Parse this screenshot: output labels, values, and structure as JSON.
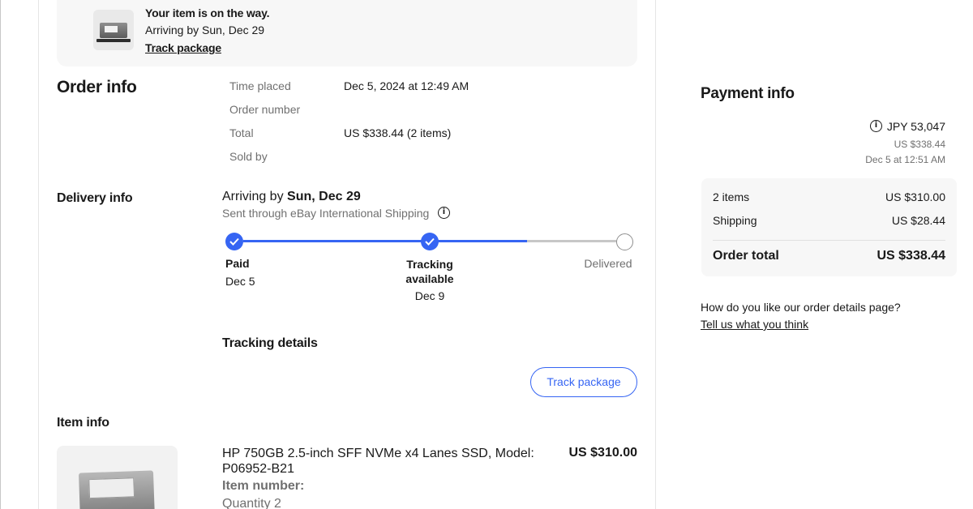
{
  "banner": {
    "title": "Your item is on the way.",
    "subtitle": "Arriving by Sun, Dec 29",
    "link": "Track package"
  },
  "order_info": {
    "heading": "Order info",
    "rows": [
      {
        "label": "Time placed",
        "value": "Dec 5, 2024 at 12:49 AM"
      },
      {
        "label": "Order number",
        "value": ""
      },
      {
        "label": "Total",
        "value": "US $338.44 (2 items)"
      },
      {
        "label": "Sold by",
        "value": ""
      }
    ]
  },
  "delivery": {
    "heading": "Delivery info",
    "arriving_prefix": "Arriving by ",
    "arriving_date": "Sun, Dec 29",
    "shipping_note": "Sent through eBay International Shipping",
    "info_icon": "i",
    "steps": [
      {
        "label": "Paid",
        "date": "Dec 5",
        "done": true
      },
      {
        "label": "Tracking available",
        "date": "Dec 9",
        "done": true
      },
      {
        "label": "Delivered",
        "date": "",
        "done": false
      }
    ],
    "tracking_heading": "Tracking details",
    "track_button": "Track package"
  },
  "item_info": {
    "heading": "Item info",
    "title": "HP 750GB 2.5-inch SFF NVMe x4 Lanes SSD, Model: P06952-B21",
    "price": "US $310.00",
    "item_number_label": "Item number:",
    "quantity": "Quantity 2"
  },
  "payment": {
    "heading": "Payment info",
    "jpy_amount": "JPY 53,047",
    "usd_amount": "US $338.44",
    "date": "Dec 5 at 12:51 AM",
    "items_label": "2 items",
    "items_value": "US $310.00",
    "shipping_label": "Shipping",
    "shipping_value": "US $28.44",
    "total_label": "Order total",
    "total_value": "US $338.44"
  },
  "feedback": {
    "question": "How do you like our order details page?",
    "link": "Tell us what you think"
  },
  "colors": {
    "accent": "#3665f3",
    "muted_text": "#707070",
    "panel_bg": "#f7f7f7"
  }
}
